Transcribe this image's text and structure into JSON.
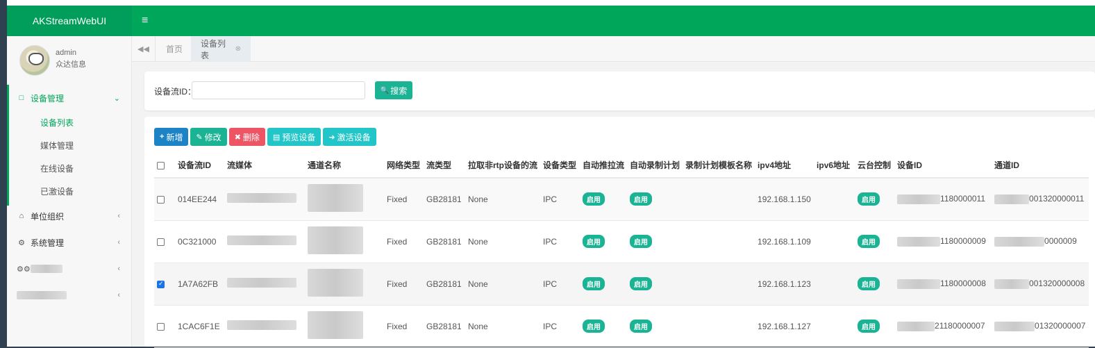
{
  "brand": {
    "title": "AKStreamWebUI"
  },
  "topbar": {
    "menu_icon": "≡"
  },
  "user": {
    "name": "admin",
    "org": "众达信息"
  },
  "sidebar": {
    "groups": [
      {
        "label": "设备管理",
        "icon": "□",
        "expanded": true,
        "children": [
          "设备列表",
          "媒体管理",
          "在线设备",
          "已激设备"
        ],
        "active_child": "设备列表"
      },
      {
        "label": "单位组织",
        "icon": "⌂"
      },
      {
        "label": "系统管理",
        "icon": "⚙"
      },
      {
        "label": "",
        "icon": "⚙⚙"
      },
      {
        "label": "",
        "icon": ""
      }
    ]
  },
  "tabs": {
    "back_icon": "◀◀",
    "items": [
      {
        "label": "首页"
      },
      {
        "label": "设备列表",
        "close": "⊗"
      }
    ]
  },
  "search": {
    "label": "设备流ID：",
    "value": "",
    "button": "搜索",
    "button_icon": "🔍"
  },
  "toolbar": {
    "add": "新增",
    "edit": "修改",
    "delete": "删除",
    "preview": "预览设备",
    "activate": "激活设备"
  },
  "table": {
    "columns": [
      "设备流ID",
      "流媒体",
      "通道名称",
      "网络类型",
      "流类型",
      "拉取非rtp设备的流",
      "设备类型",
      "自动推拉流",
      "自动录制计划",
      "录制计划模板名称",
      "ipv4地址",
      "ipv6地址",
      "云台控制",
      "设备ID",
      "通道ID"
    ],
    "rows": [
      {
        "id": "014EE244",
        "net": "Fixed",
        "stream": "GB28181",
        "pull": "None",
        "dtype": "IPC",
        "auto_push": "启用",
        "auto_rec": "启用",
        "tmpl": "",
        "ipv4": "192.168.1.150",
        "ipv6": "",
        "ptz": "启用",
        "device_id": "1180000011",
        "channel_id": "001320000011",
        "checked": false
      },
      {
        "id": "0C321000",
        "net": "Fixed",
        "stream": "GB28181",
        "pull": "None",
        "dtype": "IPC",
        "auto_push": "启用",
        "auto_rec": "启用",
        "tmpl": "",
        "ipv4": "192.168.1.109",
        "ipv6": "",
        "ptz": "启用",
        "device_id": "1180000009",
        "channel_id": "0000009",
        "checked": false
      },
      {
        "id": "1A7A62FB",
        "net": "Fixed",
        "stream": "GB28181",
        "pull": "None",
        "dtype": "IPC",
        "auto_push": "启用",
        "auto_rec": "启用",
        "tmpl": "",
        "ipv4": "192.168.1.123",
        "ipv6": "",
        "ptz": "启用",
        "device_id": "1180000008",
        "channel_id": "001320000008",
        "checked": true
      },
      {
        "id": "1CAC6F1E",
        "net": "Fixed",
        "stream": "GB28181",
        "pull": "None",
        "dtype": "IPC",
        "auto_push": "启用",
        "auto_rec": "启用",
        "tmpl": "",
        "ipv4": "192.168.1.127",
        "ipv6": "",
        "ptz": "启用",
        "device_id": "21180000007",
        "channel_id": "01320000007",
        "checked": false
      }
    ]
  },
  "colors": {
    "brand_green": "#00a65a",
    "badge": "#1ab394",
    "add": "#1c84c6",
    "delete": "#ed5565",
    "cyan": "#23c6c8"
  }
}
